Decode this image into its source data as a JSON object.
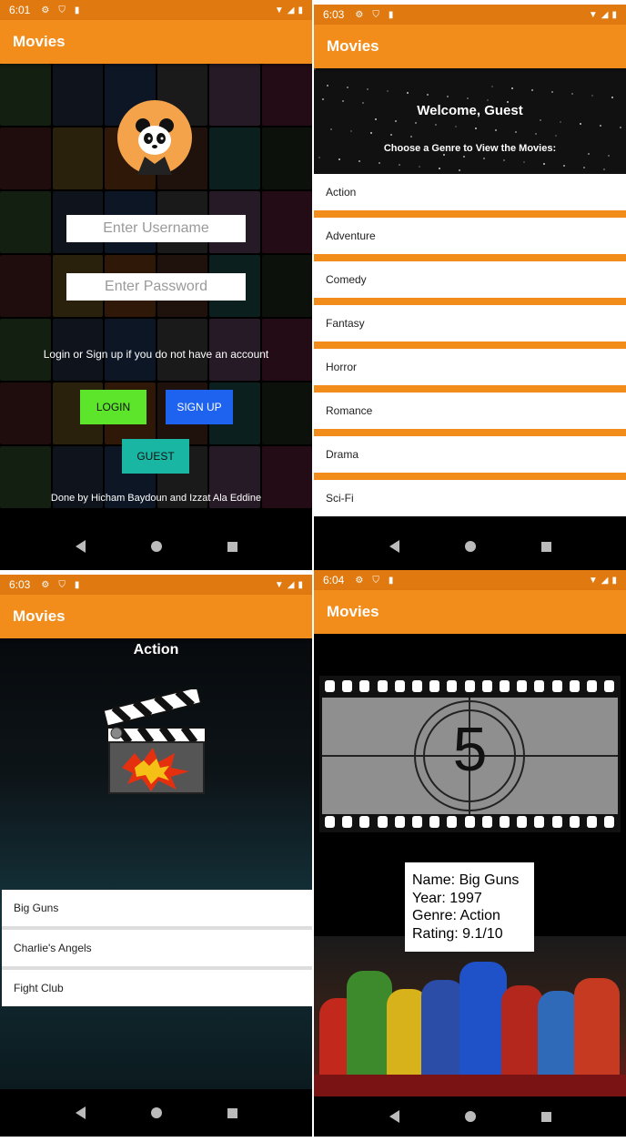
{
  "app_title": "Movies",
  "icons": {
    "back": "back-triangle",
    "home": "home-circle",
    "recent": "recent-square"
  },
  "screen1": {
    "time": "6:01",
    "username_placeholder": "Enter Username",
    "password_placeholder": "Enter Password",
    "hint": "Login or Sign up if you do not have an account",
    "login": "LOGIN",
    "signup": "SIGN UP",
    "guest": "GUEST",
    "credit": "Done by Hicham Baydoun and Izzat Ala Eddine",
    "colors": {
      "login": "#5CE52A",
      "signup": "#1E63F0",
      "guest": "#19B7A3"
    }
  },
  "screen2": {
    "time": "6:03",
    "welcome": "Welcome, Guest",
    "choose": "Choose a Genre to View the Movies:",
    "genres": [
      "Action",
      "Adventure",
      "Comedy",
      "Fantasy",
      "Horror",
      "Romance",
      "Drama",
      "Sci-Fi"
    ]
  },
  "screen3": {
    "time": "6:03",
    "title": "Action",
    "movies": [
      "Big Guns",
      "Charlie's Angels",
      "Fight Club"
    ]
  },
  "screen4": {
    "time": "6:04",
    "countdown": "5",
    "name": "Name: Big Guns",
    "year": "Year: 1997",
    "genre": "Genre: Action",
    "rating": "Rating: 9.1/10"
  },
  "theme": {
    "primary": "#F28C1A",
    "status": "#E07A10"
  }
}
